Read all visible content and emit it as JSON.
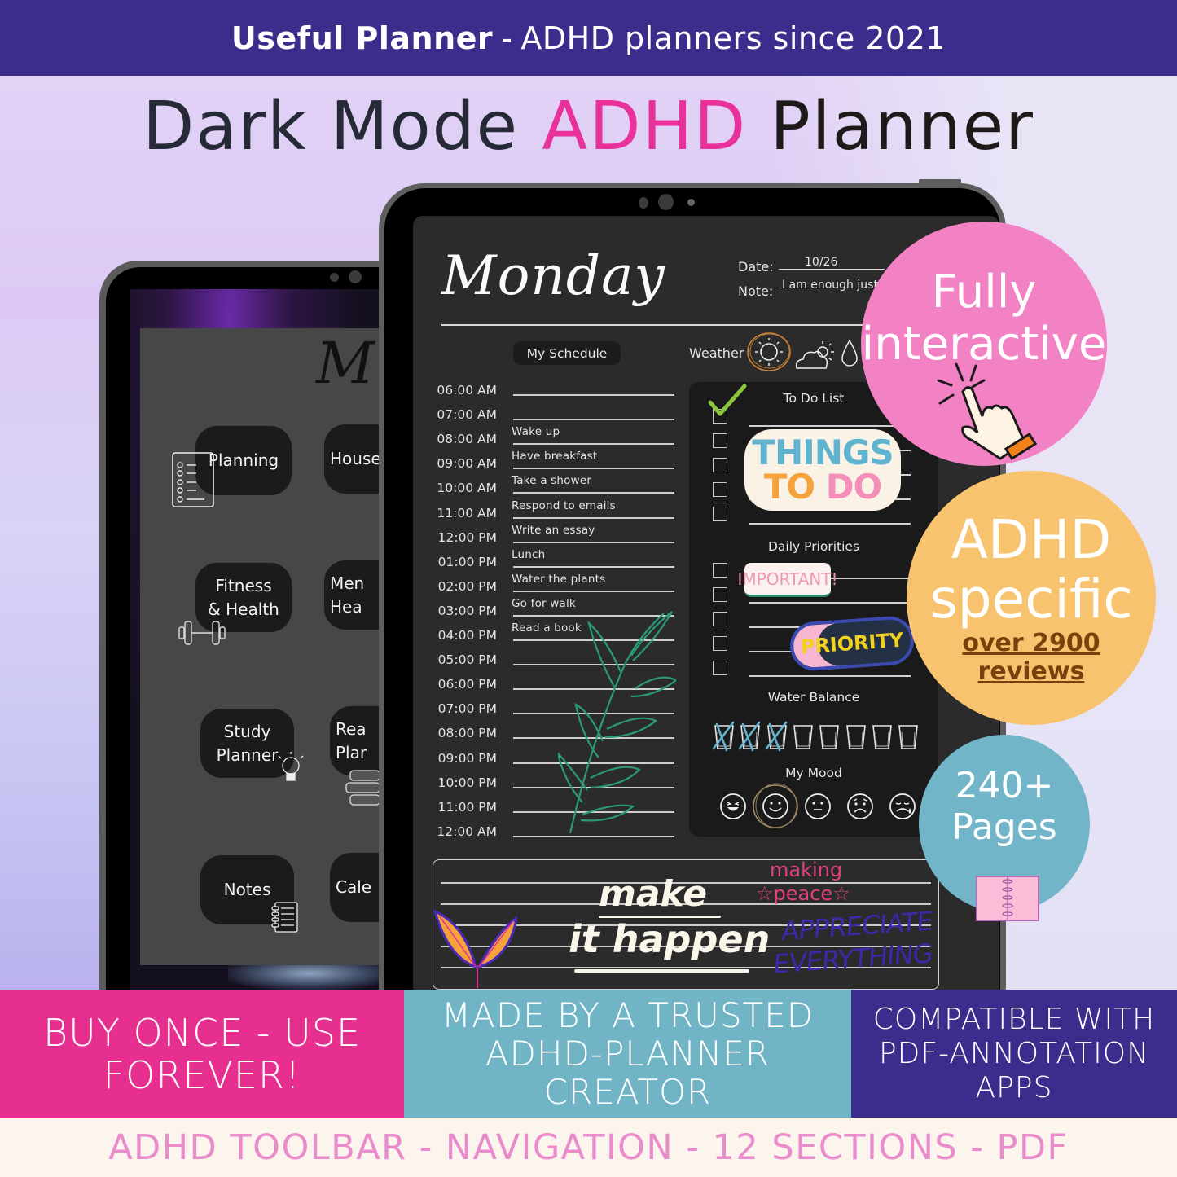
{
  "top_banner": {
    "brand": "Useful Planner",
    "separator": "-",
    "tagline": "ADHD planners since 2021"
  },
  "headline": {
    "part1": "Dark Mode",
    "accent": "ADHD",
    "part2": "Planner",
    "accent_color": "#e8319a"
  },
  "back_tablet": {
    "title_glyph": "M",
    "menu_items": [
      {
        "label_line1": "Planning",
        "label_line2": "",
        "icon": "checklist-icon"
      },
      {
        "label_line1": "House",
        "label_line2": "",
        "icon": ""
      },
      {
        "label_line1": "Fitness",
        "label_line2": "& Health",
        "icon": "dumbbell-icon"
      },
      {
        "label_line1": "Men",
        "label_line2": "Hea",
        "icon": ""
      },
      {
        "label_line1": "Study",
        "label_line2": "Planner",
        "icon": "lightbulb-icon"
      },
      {
        "label_line1": "Rea",
        "label_line2": "Plar",
        "icon": "books-icon"
      },
      {
        "label_line1": "Notes",
        "label_line2": "",
        "icon": "notebook-icon"
      },
      {
        "label_line1": "Cale",
        "label_line2": "",
        "icon": ""
      }
    ]
  },
  "daily_page": {
    "day": "Monday",
    "date_label": "Date:",
    "date_value": "10/26",
    "note_label": "Note:",
    "note_value": "I am enough just",
    "schedule_label": "My Schedule",
    "weather_label": "Weather",
    "weather_icons": [
      "sun-icon",
      "partly-cloudy-icon",
      "rain-drop-icon"
    ],
    "weather_selected": "sun-icon",
    "schedule": [
      {
        "time": "06:00 AM",
        "task": ""
      },
      {
        "time": "07:00 AM",
        "task": ""
      },
      {
        "time": "08:00 AM",
        "task": "Wake up"
      },
      {
        "time": "09:00 AM",
        "task": "Have breakfast"
      },
      {
        "time": "10:00 AM",
        "task": "Take a shower"
      },
      {
        "time": "11:00 AM",
        "task": "Respond to emails"
      },
      {
        "time": "12:00 PM",
        "task": "Write an essay"
      },
      {
        "time": "01:00 PM",
        "task": "Lunch"
      },
      {
        "time": "02:00 PM",
        "task": "Water the plants"
      },
      {
        "time": "03:00 PM",
        "task": "Go for walk"
      },
      {
        "time": "04:00 PM",
        "task": "Read a book"
      },
      {
        "time": "05:00 PM",
        "task": ""
      },
      {
        "time": "06:00 PM",
        "task": ""
      },
      {
        "time": "07:00 PM",
        "task": ""
      },
      {
        "time": "08:00 PM",
        "task": ""
      },
      {
        "time": "09:00 PM",
        "task": ""
      },
      {
        "time": "10:00 PM",
        "task": ""
      },
      {
        "time": "11:00 PM",
        "task": ""
      },
      {
        "time": "12:00 AM",
        "task": ""
      }
    ],
    "todo": {
      "heading": "To Do List",
      "checked": [
        true,
        false,
        false,
        false,
        false
      ],
      "sticker_line1": "THINGS",
      "sticker_line2": "TO DO"
    },
    "priorities": {
      "heading": "Daily Priorities",
      "checked": [
        false,
        false,
        false,
        false,
        false
      ],
      "sticker_important": "IMPORTANT!",
      "sticker_priority": "PRIORITY"
    },
    "water": {
      "heading": "Water Balance",
      "total_glasses": 8,
      "glasses_crossed": 3
    },
    "mood": {
      "heading": "My Mood",
      "options": [
        "laughing-face-icon",
        "smiling-face-icon",
        "neutral-face-icon",
        "sad-face-icon",
        "crying-face-icon"
      ],
      "selected": 1
    },
    "notes_doodles": {
      "make": "make",
      "it_happen": "it happen",
      "making_peace_1": "making",
      "making_peace_2": "peace",
      "appreciate_1": "APPRECIATE",
      "appreciate_2": "EVERYTHING"
    }
  },
  "badges": [
    {
      "line1": "Fully",
      "line2": "interactive",
      "icon": "pointer-hand-click-icon",
      "color": "#f382c4"
    },
    {
      "line1": "ADHD",
      "line2": "specific",
      "sub1": "over 2900",
      "sub2": "reviews",
      "color": "#f8c36e",
      "sub_color": "#7a3f0b"
    },
    {
      "line1": "240+",
      "line2": "Pages",
      "icon": "planner-book-icon",
      "color": "#72b5c8"
    }
  ],
  "tiles": [
    {
      "text1": "BUY ONCE - USE",
      "text2": "FOREVER!",
      "text3": "",
      "color": "#e72f8f"
    },
    {
      "text1": "MADE BY A TRUSTED",
      "text2": "ADHD-PLANNER",
      "text3": "CREATOR",
      "color": "#71b4c6"
    },
    {
      "text1": "COMPATIBLE WITH",
      "text2": "PDF-ANNOTATION",
      "text3": "APPS",
      "color": "#3b2d8c"
    }
  ],
  "footer": {
    "text": "ADHD TOOLBAR - NAVIGATION - 12 SECTIONS - PDF"
  }
}
